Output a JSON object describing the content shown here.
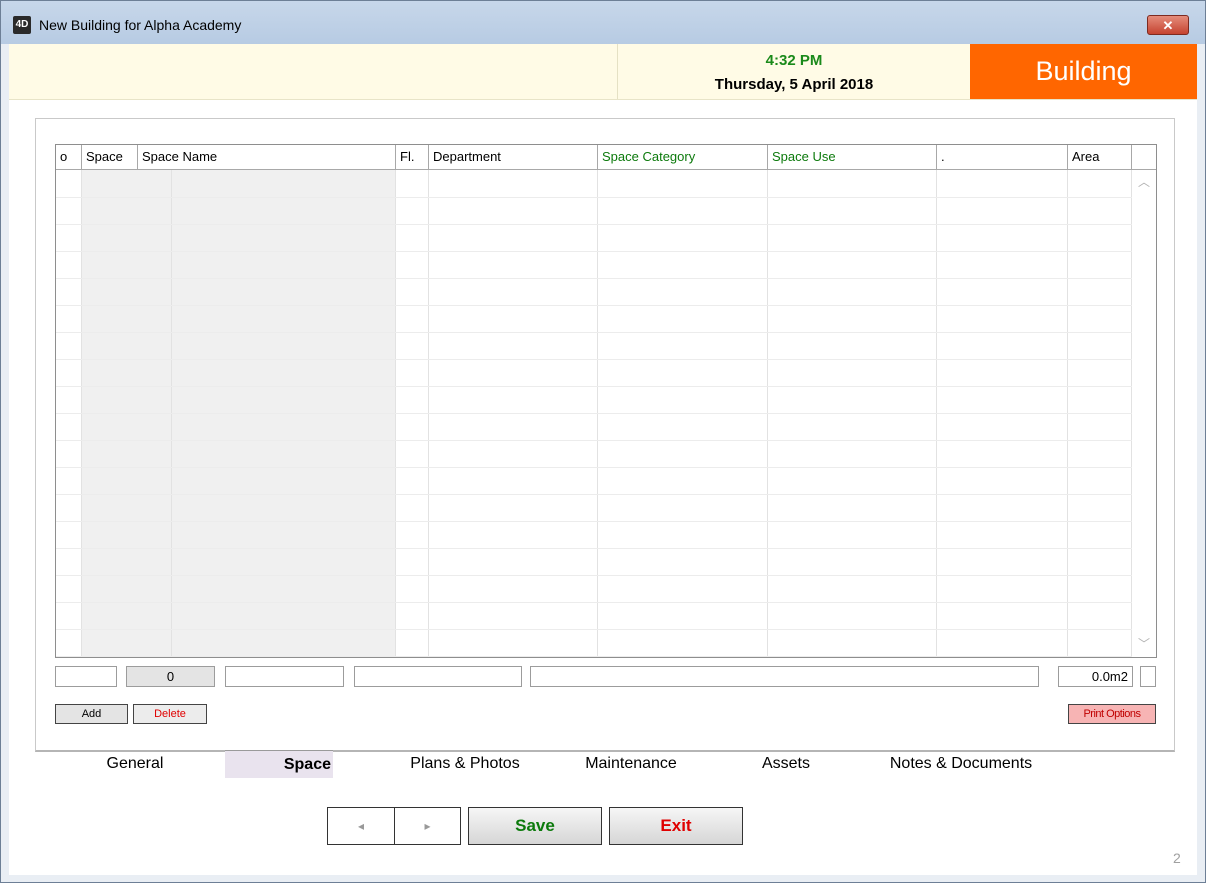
{
  "window": {
    "title": "New Building for Alpha Academy",
    "icon_label": "4D",
    "close_label": "✕"
  },
  "header": {
    "time": "4:32 PM",
    "date": "Thursday, 5 April 2018",
    "module": "Building"
  },
  "grid": {
    "columns": [
      {
        "label": "o",
        "color": "default"
      },
      {
        "label": "Space",
        "color": "default"
      },
      {
        "label": "Space Name",
        "color": "default"
      },
      {
        "label": "Fl.",
        "color": "default"
      },
      {
        "label": "Department",
        "color": "default"
      },
      {
        "label": "Space Category",
        "color": "#0c7a0c"
      },
      {
        "label": "Space Use",
        "color": "#0c7a0c"
      },
      {
        "label": ".",
        "color": "default"
      },
      {
        "label": "Area",
        "color": "default"
      }
    ],
    "scroll_up_icon": "chevron-up-icon",
    "scroll_down_icon": "chevron-down-icon"
  },
  "summary": {
    "count": "0",
    "area_total": "0.0m2"
  },
  "actions": {
    "add": "Add",
    "delete": "Delete",
    "print_options": "Print Options"
  },
  "tabs": [
    {
      "label": "General",
      "active": false
    },
    {
      "label": "Space",
      "active": true
    },
    {
      "label": "Plans & Photos",
      "active": false
    },
    {
      "label": "Maintenance",
      "active": false
    },
    {
      "label": "Assets",
      "active": false
    },
    {
      "label": "Notes & Documents",
      "active": false
    }
  ],
  "footer": {
    "prev_icon": "◂",
    "next_icon": "▸",
    "save": "Save",
    "exit": "Exit",
    "page": "2"
  },
  "colors": {
    "accent": "#ff6600",
    "time": "#1a8a1a",
    "save": "#0c7a0c",
    "exit": "#e00000",
    "delete": "#e00000",
    "print_bg": "#f7b4b4"
  }
}
